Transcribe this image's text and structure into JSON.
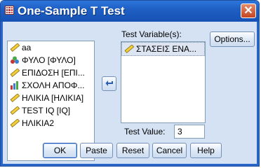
{
  "window": {
    "title": "One-Sample T Test",
    "close_label": "✕"
  },
  "variables": [
    {
      "label": "aa",
      "icon": "scale-ruler-icon"
    },
    {
      "label": "ΦΥΛΟ [ΦΥΛΟ]",
      "icon": "nominal-circles-icon"
    },
    {
      "label": "ΕΠΙΔΟΣΗ [ΕΠΙ...",
      "icon": "scale-ruler-icon"
    },
    {
      "label": "ΣΧΟΛΗ ΑΠΟΦ...",
      "icon": "ordinal-bars-icon"
    },
    {
      "label": "ΗΛΙΚΙΑ [ΗΛΙΚΙΑ]",
      "icon": "scale-ruler-icon"
    },
    {
      "label": "TEST IQ [IQ]",
      "icon": "scale-ruler-icon"
    },
    {
      "label": "ΗΛΙΚΙΑ2",
      "icon": "scale-ruler-icon"
    }
  ],
  "test_variables": {
    "label": "Test Variable(s):",
    "items": [
      {
        "label": "ΣΤΑΣΕΙΣ ΕΝΑ...",
        "icon": "scale-ruler-icon"
      }
    ]
  },
  "buttons": {
    "options": "Options...",
    "ok": "OK",
    "paste": "Paste",
    "reset": "Reset",
    "cancel": "Cancel",
    "help": "Help"
  },
  "test_value": {
    "label": "Test Value:",
    "value": "3"
  },
  "move_button_icon": "arrow-left-icon"
}
